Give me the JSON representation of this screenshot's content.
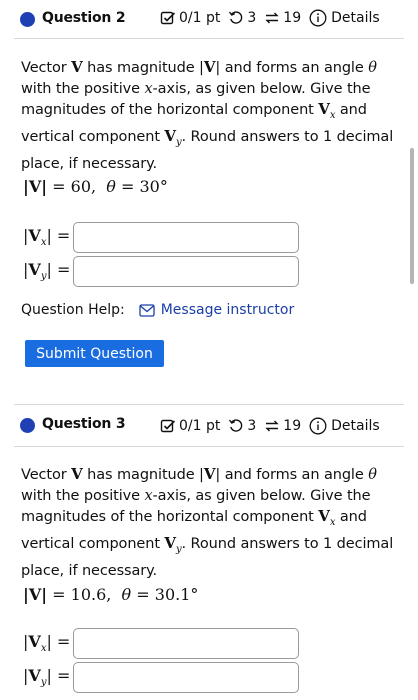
{
  "questions": [
    {
      "title": "Question 2",
      "score": "0/1 pt",
      "retries": "3",
      "attempts": "19",
      "details_label": "Details",
      "text": {
        "p1": "Vector ",
        "v1": "V",
        "p2": " has magnitude |",
        "v2": "V",
        "p3": "| and forms an angle ",
        "theta": "θ",
        "p4": " with the positive ",
        "x": "x",
        "p5": "-axis, as given below. Give the magnitudes of the horizontal component ",
        "vx": "V",
        "vx_sub": "x",
        "p6": " and vertical component ",
        "vy": "V",
        "vy_sub": "y",
        "p7": ". Round answers to 1 decimal place, if necessary."
      },
      "given": {
        "mag_label": "|V|",
        "mag_value": "= 60,",
        "theta_label": "θ",
        "theta_value": "= 30°"
      },
      "answers": [
        {
          "label_pre": "|",
          "label_bold": "V",
          "label_sub": "x",
          "label_post": "| =",
          "value": "",
          "placeholder": ""
        },
        {
          "label_pre": "|",
          "label_bold": "V",
          "label_sub": "y",
          "label_post": "| =",
          "value": "",
          "placeholder": ""
        }
      ]
    },
    {
      "title": "Question 3",
      "score": "0/1 pt",
      "retries": "3",
      "attempts": "19",
      "details_label": "Details",
      "text": {
        "p1": "Vector ",
        "v1": "V",
        "p2": " has magnitude |",
        "v2": "V",
        "p3": "| and forms an angle ",
        "theta": "θ",
        "p4": " with the positive ",
        "x": "x",
        "p5": "-axis, as given below. Give the magnitudes of the horizontal component ",
        "vx": "V",
        "vx_sub": "x",
        "p6": " and vertical component ",
        "vy": "V",
        "vy_sub": "y",
        "p7": ". Round answers to 1 decimal place, if necessary."
      },
      "given": {
        "mag_label": "|V|",
        "mag_value": "= 10.6,",
        "theta_label": "θ",
        "theta_value": "= 30.1°"
      },
      "answers": [
        {
          "label_pre": "|",
          "label_bold": "V",
          "label_sub": "x",
          "label_post": "| =",
          "value": "",
          "placeholder": ""
        },
        {
          "label_pre": "|",
          "label_bold": "V",
          "label_sub": "y",
          "label_post": "| =",
          "value": "",
          "placeholder": ""
        }
      ]
    }
  ],
  "help": {
    "label": "Question Help:",
    "message_label": "Message instructor"
  },
  "submit_label": "Submit Question",
  "colors": {
    "accent": "#1f3fb5",
    "link": "#1a3fa8",
    "button": "#1a6de0",
    "divider": "#d8d8d8"
  },
  "icons": {
    "score": "checkbox-pencil-icon",
    "retries": "retry-arrow-icon",
    "attempts": "swap-arrows-icon",
    "details": "info-circle-icon",
    "message": "mail-icon"
  }
}
